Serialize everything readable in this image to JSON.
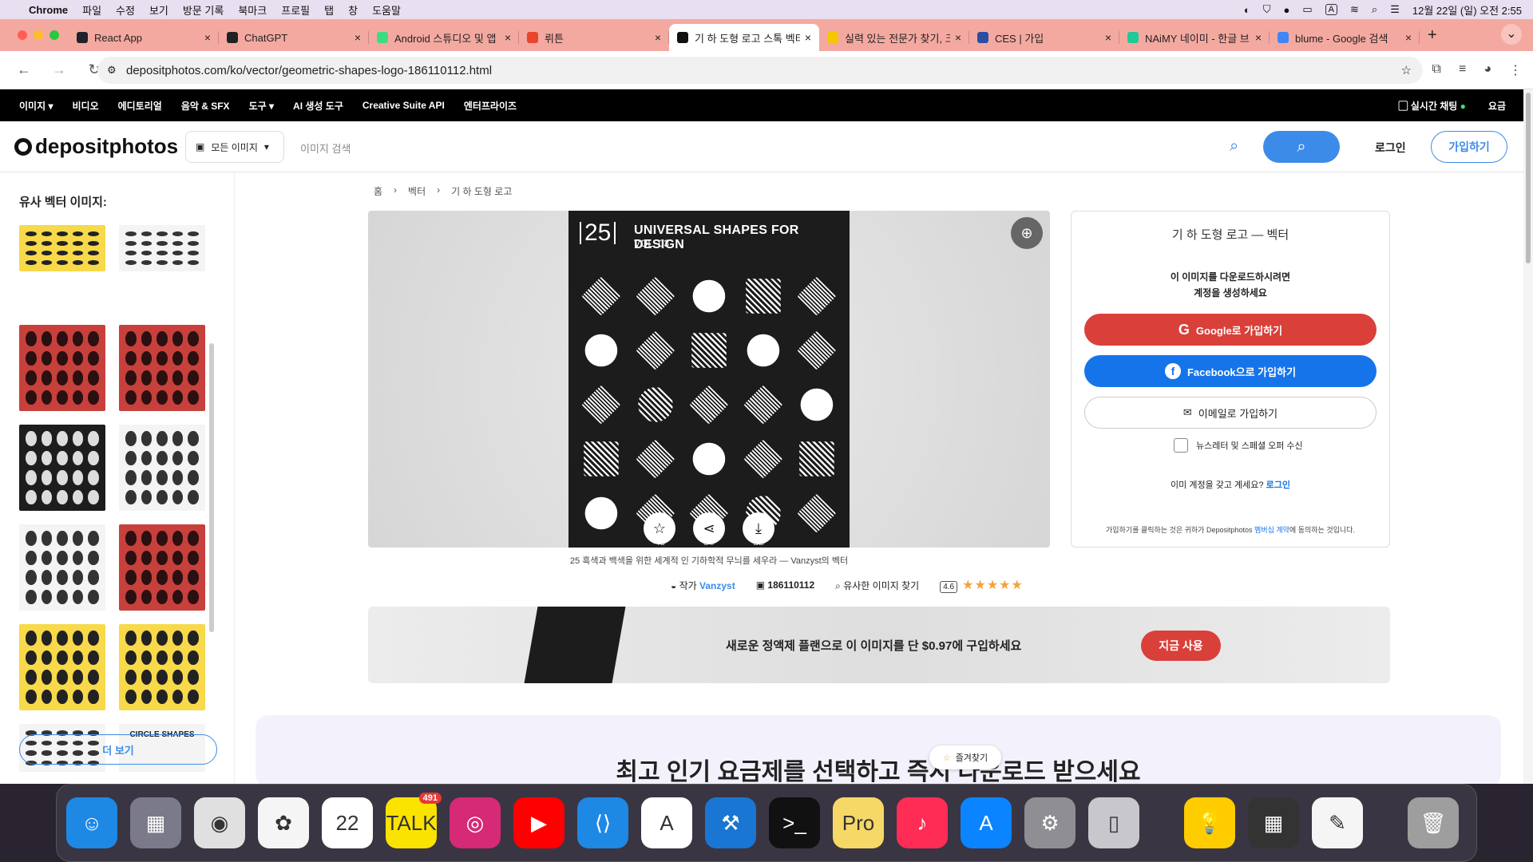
{
  "menubar": {
    "apple": "",
    "items": [
      "Chrome",
      "파일",
      "수정",
      "보기",
      "방문 기록",
      "북마크",
      "프로필",
      "탭",
      "창",
      "도움말"
    ],
    "clock": "12월 22일 (일) 오전 2:55",
    "input_mode": "A"
  },
  "tabs": [
    {
      "title": "React App",
      "color": "#20232a"
    },
    {
      "title": "ChatGPT",
      "color": "#222222"
    },
    {
      "title": "Android 스튜디오 및 앱",
      "color": "#3ddc84"
    },
    {
      "title": "뤼튼",
      "color": "#e8452c"
    },
    {
      "title": "기 하 도형 로고 스톡 벡터",
      "color": "#111111"
    },
    {
      "title": "실력 있는 전문가 찾기, 크",
      "color": "#f7c600"
    },
    {
      "title": "CES | 가입",
      "color": "#2b4ea2"
    },
    {
      "title": "NAiMY 네이미 - 한글 브",
      "color": "#20c997"
    },
    {
      "title": "blume - Google 검색",
      "color": "#4285f4"
    }
  ],
  "address": {
    "url": "depositphotos.com/ko/vector/geometric-shapes-logo-186110112.html"
  },
  "topnav": {
    "items": [
      "이미지 ▾",
      "비디오",
      "에디토리얼",
      "음악 & SFX",
      "도구 ▾",
      "AI 생성 도구",
      "Creative Suite API",
      "엔터프라이즈"
    ],
    "chat": "실시간 채팅",
    "pricing": "요금"
  },
  "header": {
    "logo": "depositphotos",
    "category": "모든 이미지",
    "search_placeholder": "이미지 검색",
    "login": "로그인",
    "signup": "가입하기"
  },
  "sidebar": {
    "title": "유사 벡터 이미지:",
    "thumbs": [
      {
        "bg": "y",
        "caption": ""
      },
      {
        "bg": "w",
        "caption": ""
      },
      {
        "bg": "r",
        "caption": ""
      },
      {
        "bg": "r",
        "caption": ""
      },
      {
        "bg": "k",
        "caption": ""
      },
      {
        "bg": "w",
        "caption": ""
      },
      {
        "bg": "w",
        "caption": ""
      },
      {
        "bg": "r",
        "caption": ""
      },
      {
        "bg": "y",
        "caption": ""
      },
      {
        "bg": "y",
        "caption": ""
      },
      {
        "bg": "w",
        "caption": ""
      },
      {
        "bg": "w",
        "caption": "CIRCLE SHAPES"
      }
    ],
    "more": "더 보기"
  },
  "breadcrumb": [
    "홈",
    "›",
    "벡터",
    "›",
    "기 하 도형 로고"
  ],
  "artwork": {
    "number": "25",
    "title": "UNIVERSAL SHAPES FOR DESIGN",
    "vol": "VOL. 03",
    "actions": [
      "저장",
      "공유",
      "샘플"
    ]
  },
  "caption": "25 흑색과 백색을 위한 세계적 인 기하학적 무늬를 세우라 — Vanzyst의 벡터",
  "meta": {
    "author_label": "작가",
    "author": "Vanzyst",
    "id": "186110112",
    "similar": "유사한 이미지 찾기",
    "rating": "4.6",
    "stars": "★★★★★"
  },
  "panel": {
    "heading": "기 하 도형 로고 — 벡터",
    "sub1": "이 이미지를 다운로드하시려면",
    "sub2": "계정을 생성하세요",
    "google": "Google로 가입하기",
    "facebook": "Facebook으로 가입하기",
    "email": "이메일로 가입하기",
    "newsletter": "뉴스레터 및 스페셜 오퍼 수신",
    "already": "이미 계정을 갖고 계세요?",
    "already_link": "로그인",
    "terms_pre": "가입하기를 클릭하는 것은 귀하가 Depositphotos",
    "terms_link": "멤버십 계약",
    "terms_post": "에 동의하는 것입니다."
  },
  "promo": {
    "text": "새로운 정액제 플랜으로 이 이미지를 단 $0.97에 구입하세요",
    "button": "지금 사용"
  },
  "bottom": {
    "title": "최고 인기 요금제를 선택하고 즉시 다운로드 받으세요"
  },
  "favorites": "즐겨찾기",
  "dock": [
    {
      "name": "finder",
      "color": "#1e88e5",
      "glyph": "☺"
    },
    {
      "name": "launchpad",
      "color": "#7a7a8a",
      "glyph": "▦"
    },
    {
      "name": "chrome",
      "color": "#e0e0e0",
      "glyph": "◉"
    },
    {
      "name": "photos",
      "color": "#f5f5f5",
      "glyph": "✿"
    },
    {
      "name": "calendar",
      "color": "#ffffff",
      "glyph": "22"
    },
    {
      "name": "kakaotalk",
      "color": "#fbe300",
      "glyph": "TALK",
      "badge": "491"
    },
    {
      "name": "instagram",
      "color": "#d62976",
      "glyph": "◎"
    },
    {
      "name": "youtube",
      "color": "#ff0000",
      "glyph": "▶"
    },
    {
      "name": "vscode",
      "color": "#1e88e5",
      "glyph": "⟨⟩"
    },
    {
      "name": "android-studio",
      "color": "#ffffff",
      "glyph": "A"
    },
    {
      "name": "xcode",
      "color": "#1976d2",
      "glyph": "⚒"
    },
    {
      "name": "terminal",
      "color": "#111111",
      "glyph": ">_"
    },
    {
      "name": "notes-pro",
      "color": "#f6d866",
      "glyph": "Pro"
    },
    {
      "name": "music",
      "color": "#ff2d55",
      "glyph": "♪"
    },
    {
      "name": "app-store",
      "color": "#0a84ff",
      "glyph": "A"
    },
    {
      "name": "system-settings",
      "color": "#8e8e93",
      "glyph": "⚙"
    },
    {
      "name": "iphone-mirroring",
      "color": "#c7c7cc",
      "glyph": "▯"
    },
    {
      "name": "tips",
      "color": "#ffcc00",
      "glyph": "💡"
    },
    {
      "name": "calculator",
      "color": "#333333",
      "glyph": "▦"
    },
    {
      "name": "textedit",
      "color": "#f5f5f5",
      "glyph": "✎"
    },
    {
      "name": "trash",
      "color": "#9e9e9e",
      "glyph": "🗑"
    }
  ]
}
